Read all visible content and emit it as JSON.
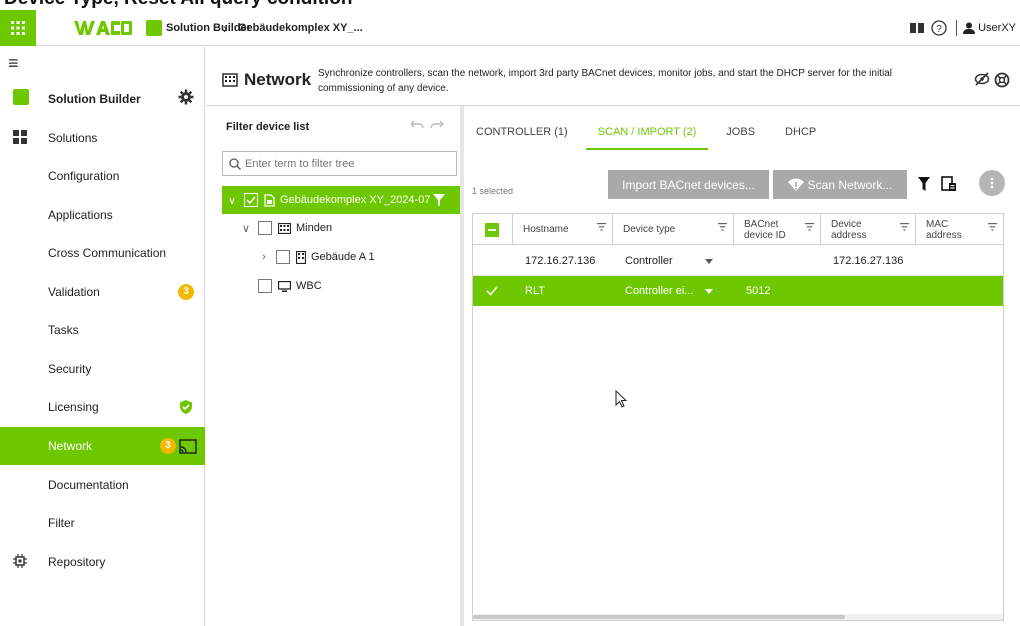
{
  "caption": "Device Type, Reset All query condition",
  "topbar": {
    "app_title": "Solution Builder",
    "breadcrumb_sep": "›",
    "breadcrumb_project": "Gebäudekomplex XY_...",
    "user": "UserXY"
  },
  "sidebar": {
    "header": "Solution Builder",
    "items": [
      {
        "label": "Solutions",
        "icon": "solutions-icon"
      },
      {
        "label": "Configuration"
      },
      {
        "label": "Applications"
      },
      {
        "label": "Cross Communication"
      },
      {
        "label": "Validation",
        "badge": "3"
      },
      {
        "label": "Tasks"
      },
      {
        "label": "Security"
      },
      {
        "label": "Licensing",
        "icon": "shield-check-icon"
      },
      {
        "label": "Network",
        "badge": "3",
        "active": true,
        "icon": "cast-icon"
      },
      {
        "label": "Documentation"
      },
      {
        "label": "Filter"
      },
      {
        "label": "Repository",
        "icon": "chip-icon"
      }
    ]
  },
  "network": {
    "title": "Network",
    "description": "Synchronize controllers, scan the network, import 3rd party BACnet devices, monitor jobs, and start the DHCP server for the initial commissioning of any device."
  },
  "filter_panel": {
    "title": "Filter device list",
    "placeholder": "Enter term to filter tree",
    "tree": [
      {
        "label": "Gebäudekomplex XY_2024-07",
        "selected": true
      },
      {
        "label": "Minden"
      },
      {
        "label": "Gebäude A 1"
      },
      {
        "label": "WBC"
      }
    ]
  },
  "tabs": [
    "CONTROLLER (1)",
    "SCAN / IMPORT (2)",
    "JOBS",
    "DHCP"
  ],
  "active_tab": 1,
  "toolbar": {
    "selected_count": "1 selected",
    "import_label": "Import BACnet devices...",
    "scan_label": "Scan Network..."
  },
  "table": {
    "columns": [
      "Hostname",
      "Device type",
      "BACnet device ID",
      "Device address",
      "MAC address"
    ],
    "rows": [
      {
        "hostname": "172.16.27.136",
        "device_type": "Controller",
        "bacnet_id": "",
        "address": "172.16.27.136",
        "mac": "",
        "selected": false
      },
      {
        "hostname": "RLT",
        "device_type": "Controller ei...",
        "bacnet_id": "5012",
        "address": "",
        "mac": "",
        "selected": true
      }
    ]
  },
  "colors": {
    "accent": "#6ec800",
    "badge": "#f5b800",
    "button": "#a9a9a9"
  }
}
